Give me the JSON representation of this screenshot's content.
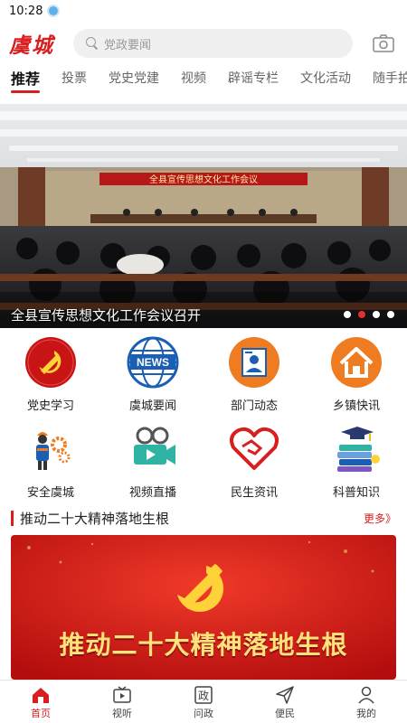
{
  "status_bar": {
    "time": "10:28"
  },
  "header": {
    "logo": "虞城",
    "search_placeholder": "党政要闻"
  },
  "tabs": [
    {
      "label": "推荐",
      "active": true
    },
    {
      "label": "投票"
    },
    {
      "label": "党史党建"
    },
    {
      "label": "视频"
    },
    {
      "label": "辟谣专栏"
    },
    {
      "label": "文化活动"
    },
    {
      "label": "随手拍"
    }
  ],
  "banner": {
    "stage_text": "全县宣传思想文化工作会议",
    "caption": "全县宣传思想文化工作会议召开",
    "slide_count": 4,
    "active_slide": 2
  },
  "quick_links": [
    {
      "label": "党史学习",
      "icon": "party-emblem-icon"
    },
    {
      "label": "虞城要闻",
      "icon": "news-globe-icon"
    },
    {
      "label": "部门动态",
      "icon": "department-icon"
    },
    {
      "label": "乡镇快讯",
      "icon": "house-icon"
    },
    {
      "label": "安全虞城",
      "icon": "safety-worker-icon"
    },
    {
      "label": "视频直播",
      "icon": "video-camera-icon"
    },
    {
      "label": "民生资讯",
      "icon": "handshake-icon"
    },
    {
      "label": "科普知识",
      "icon": "books-icon"
    }
  ],
  "section": {
    "title": "推动二十大精神落地生根",
    "more": "更多》"
  },
  "feature": {
    "text": "推动二十大精神落地生根"
  },
  "bottom_nav": [
    {
      "label": "首页",
      "icon": "home-icon",
      "active": true
    },
    {
      "label": "视听",
      "icon": "tv-icon"
    },
    {
      "label": "问政",
      "icon": "inquiry-icon"
    },
    {
      "label": "便民",
      "icon": "send-icon"
    },
    {
      "label": "我的",
      "icon": "user-icon"
    }
  ],
  "colors": {
    "brand": "#d81e1e",
    "accent_orange": "#f07c22",
    "news_blue": "#1a5fb4"
  }
}
